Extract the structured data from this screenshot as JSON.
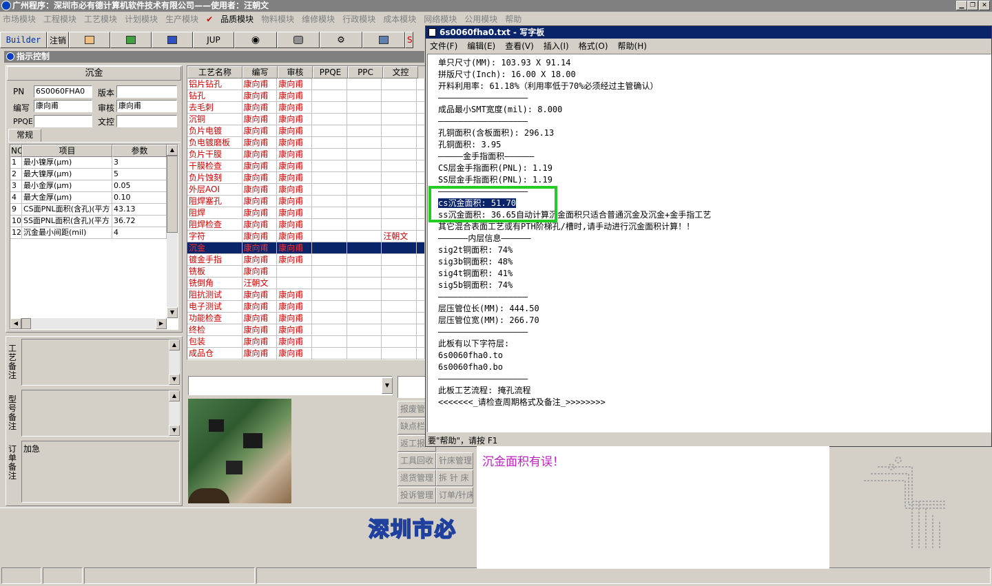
{
  "app": {
    "title": "广州程序：深圳市必有德计算机软件技术有限公司——使用者：汪朝文"
  },
  "menu": [
    "市场模块",
    "工程模块",
    "工艺模块",
    "计划模块",
    "生产模块",
    "品质模块",
    "物料模块",
    "维修模块",
    "行政模块",
    "成本模块",
    "网络模块",
    "公用模块",
    "帮助"
  ],
  "toolbar": {
    "builder": "Builder",
    "logout": "注销",
    "jup": "JUP",
    "s_label": "S"
  },
  "panel": {
    "title": "指示控制",
    "section": "沉金"
  },
  "form": {
    "pn_label": "PN",
    "pn_value": "6S0060FHA0",
    "version_label": "版本",
    "version_value": "",
    "writer_label": "编写",
    "writer_value": "康向甫",
    "reviewer_label": "审核",
    "reviewer_value": "康向甫",
    "ppqe_label": "PPQE",
    "ppqe_value": "",
    "doc_label": "文控",
    "doc_value": ""
  },
  "tab": {
    "general": "常规"
  },
  "param_headers": [
    "NO",
    "项目",
    "参数"
  ],
  "params": [
    {
      "no": "1",
      "item": "最小镍厚(μm)",
      "val": "3"
    },
    {
      "no": "2",
      "item": "最大镍厚(μm)",
      "val": "5"
    },
    {
      "no": "3",
      "item": "最小金厚(μm)",
      "val": "0.05"
    },
    {
      "no": "4",
      "item": "最大金厚(μm)",
      "val": "0.10"
    },
    {
      "no": "9",
      "item": "CS面PNL面积(含孔)(平方",
      "val": "43.13"
    },
    {
      "no": "10",
      "item": "SS面PNL面积(含孔)(平方",
      "val": "36.72"
    },
    {
      "no": "12",
      "item": "沉金最小间距(mil)",
      "val": "4"
    }
  ],
  "notes": {
    "process_label": "工艺备注",
    "model_label": "型号备注",
    "order_label": "订单备注",
    "order_value": "加急"
  },
  "proc_headers": [
    "工艺名称",
    "编写",
    "审核",
    "PPQE",
    "PPC",
    "文控"
  ],
  "processes": [
    {
      "name": "铝片钻孔",
      "w": "康向甫",
      "r": "康向甫",
      "d": ""
    },
    {
      "name": "钻孔",
      "w": "康向甫",
      "r": "康向甫",
      "d": ""
    },
    {
      "name": "去毛刺",
      "w": "康向甫",
      "r": "康向甫",
      "d": ""
    },
    {
      "name": "沉铜",
      "w": "康向甫",
      "r": "康向甫",
      "d": ""
    },
    {
      "name": "负片电镀",
      "w": "康向甫",
      "r": "康向甫",
      "d": ""
    },
    {
      "name": "负电镀磨板",
      "w": "康向甫",
      "r": "康向甫",
      "d": ""
    },
    {
      "name": "负片干膜",
      "w": "康向甫",
      "r": "康向甫",
      "d": ""
    },
    {
      "name": "干膜检查",
      "w": "康向甫",
      "r": "康向甫",
      "d": ""
    },
    {
      "name": "负片蚀刻",
      "w": "康向甫",
      "r": "康向甫",
      "d": ""
    },
    {
      "name": "外层AOI",
      "w": "康向甫",
      "r": "康向甫",
      "d": ""
    },
    {
      "name": "阻焊塞孔",
      "w": "康向甫",
      "r": "康向甫",
      "d": ""
    },
    {
      "name": "阻焊",
      "w": "康向甫",
      "r": "康向甫",
      "d": ""
    },
    {
      "name": "阻焊检查",
      "w": "康向甫",
      "r": "康向甫",
      "d": ""
    },
    {
      "name": "字符",
      "w": "康向甫",
      "r": "康向甫",
      "d": "汪朝文"
    },
    {
      "name": "沉金",
      "w": "康向甫",
      "r": "康向甫",
      "d": "",
      "sel": true
    },
    {
      "name": "镀金手指",
      "w": "康向甫",
      "r": "康向甫",
      "d": ""
    },
    {
      "name": "铣板",
      "w": "康向甫",
      "r": "",
      "d": ""
    },
    {
      "name": "铣倒角",
      "w": "汪朝文",
      "r": "",
      "d": ""
    },
    {
      "name": "阻抗测试",
      "w": "康向甫",
      "r": "康向甫",
      "d": ""
    },
    {
      "name": "电子测试",
      "w": "康向甫",
      "r": "康向甫",
      "d": ""
    },
    {
      "name": "功能检查",
      "w": "康向甫",
      "r": "康向甫",
      "d": ""
    },
    {
      "name": "终检",
      "w": "康向甫",
      "r": "康向甫",
      "d": ""
    },
    {
      "name": "包装",
      "w": "康向甫",
      "r": "康向甫",
      "d": ""
    },
    {
      "name": "成品仓",
      "w": "康向甫",
      "r": "康向甫",
      "d": ""
    }
  ],
  "side_buttons": [
    [
      "报废管",
      ""
    ],
    [
      "缺点栏",
      ""
    ],
    [
      "返工报",
      ""
    ],
    [
      "工具回收",
      "针床管理"
    ],
    [
      "退货管理",
      "拆 针 床"
    ],
    [
      "投诉管理",
      "订单/针床"
    ]
  ],
  "wordpad": {
    "title": "6s0060fha0.txt - 写字板",
    "menu": [
      "文件(F)",
      "编辑(E)",
      "查看(V)",
      "插入(I)",
      "格式(O)",
      "帮助(H)"
    ],
    "lines": [
      "单只尺寸(MM): 103.93 X 91.14",
      "拼版尺寸(Inch): 16.00 X 18.00",
      "开料利用率: 61.18%（利用率低于70%必须经过主管确认）",
      "——————————————————",
      "成品最小SMT宽度(mil): 8.000",
      "——————————————————",
      "孔铜面积(含板面积): 296.13",
      "孔铜面积: 3.95",
      "—————金手指面积——————",
      "CS层金手指面积(PNL): 1.19",
      "SS层金手指面积(PNL): 1.19",
      "——————————————————",
      "cs沉金面积: 51.70",
      "ss沉金面积: 36.65自动计算沉金面积只适合普通沉金及沉金+金手指工艺",
      "其它混合表面工艺或有PTH阶梯孔/槽时,请手动进行沉金面积计算！！",
      "——————内层信息——————",
      "sig2t铜面积: 74%",
      "sig3b铜面积: 48%",
      "sig4t铜面积: 41%",
      "sig5b铜面积: 74%",
      "——————————————————",
      "层压管位长(MM): 444.50",
      "层压管位宽(MM): 266.70",
      "——————————————————",
      "此板有以下字符层:",
      "6s0060fha0.to",
      "6s0060fha0.bo",
      "——————————————————",
      "此板工艺流程: 掩孔流程",
      "<<<<<<<_请检查周期格式及备注_>>>>>>>>"
    ],
    "status": "要\"帮助\"，请按 F1"
  },
  "popup": {
    "message": "沉金面积有误！"
  },
  "banner": {
    "text": "深圳市必"
  }
}
